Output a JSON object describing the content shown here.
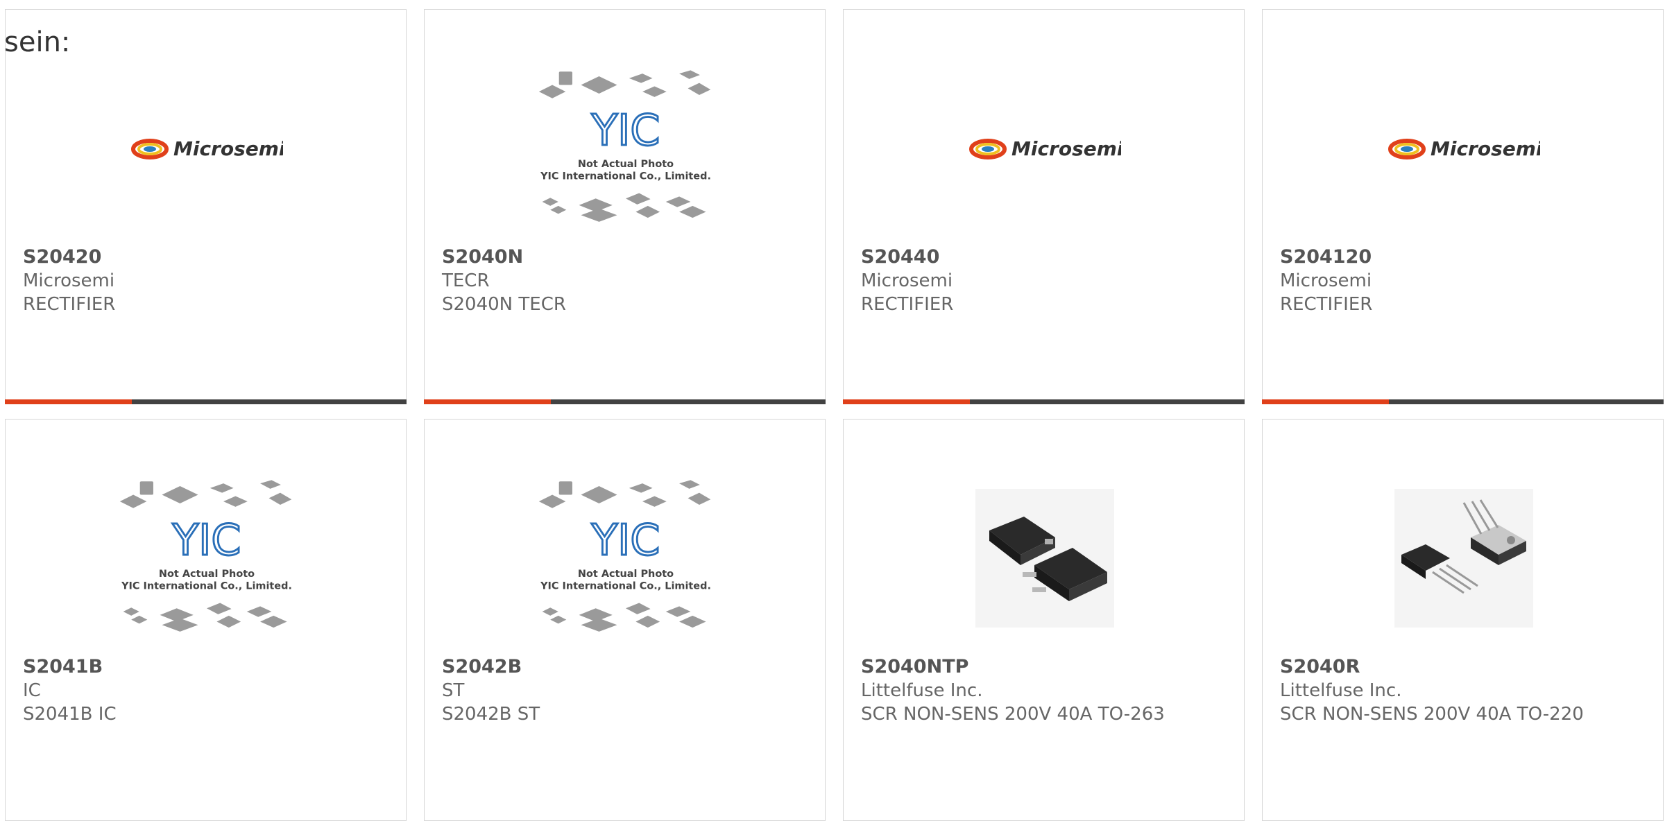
{
  "page": {
    "label": "sein:"
  },
  "products": [
    {
      "part": "S20420",
      "manufacturer": "Microsemi",
      "description": "RECTIFIER",
      "image": "microsemi-logo",
      "logo_text": "Microsemi"
    },
    {
      "part": "S2040N",
      "manufacturer": "TECR",
      "description": "S2040N TECR",
      "image": "yic-placeholder",
      "placeholder_line1": "Not Actual Photo",
      "placeholder_line2": "YIC International Co., Limited."
    },
    {
      "part": "S20440",
      "manufacturer": "Microsemi",
      "description": "RECTIFIER",
      "image": "microsemi-logo",
      "logo_text": "Microsemi"
    },
    {
      "part": "S204120",
      "manufacturer": "Microsemi",
      "description": "RECTIFIER",
      "image": "microsemi-logo",
      "logo_text": "Microsemi"
    },
    {
      "part": "S2041B",
      "manufacturer": "IC",
      "description": "S2041B IC",
      "image": "yic-placeholder",
      "placeholder_line1": "Not Actual Photo",
      "placeholder_line2": "YIC International Co., Limited."
    },
    {
      "part": "S2042B",
      "manufacturer": "ST",
      "description": "S2042B ST",
      "image": "yic-placeholder",
      "placeholder_line1": "Not Actual Photo",
      "placeholder_line2": "YIC International Co., Limited."
    },
    {
      "part": "S2040NTP",
      "manufacturer": "Littelfuse Inc.",
      "description": "SCR NON-SENS 200V 40A TO-263",
      "image": "to263-package-photo"
    },
    {
      "part": "S2040R",
      "manufacturer": "Littelfuse Inc.",
      "description": "SCR NON-SENS 200V 40A TO-220",
      "image": "to220-package-photo"
    }
  ],
  "colors": {
    "accent": "#e0401a",
    "bar": "#424242",
    "microsemi": "#c03018",
    "yic_blue": "#2a6fb8"
  }
}
